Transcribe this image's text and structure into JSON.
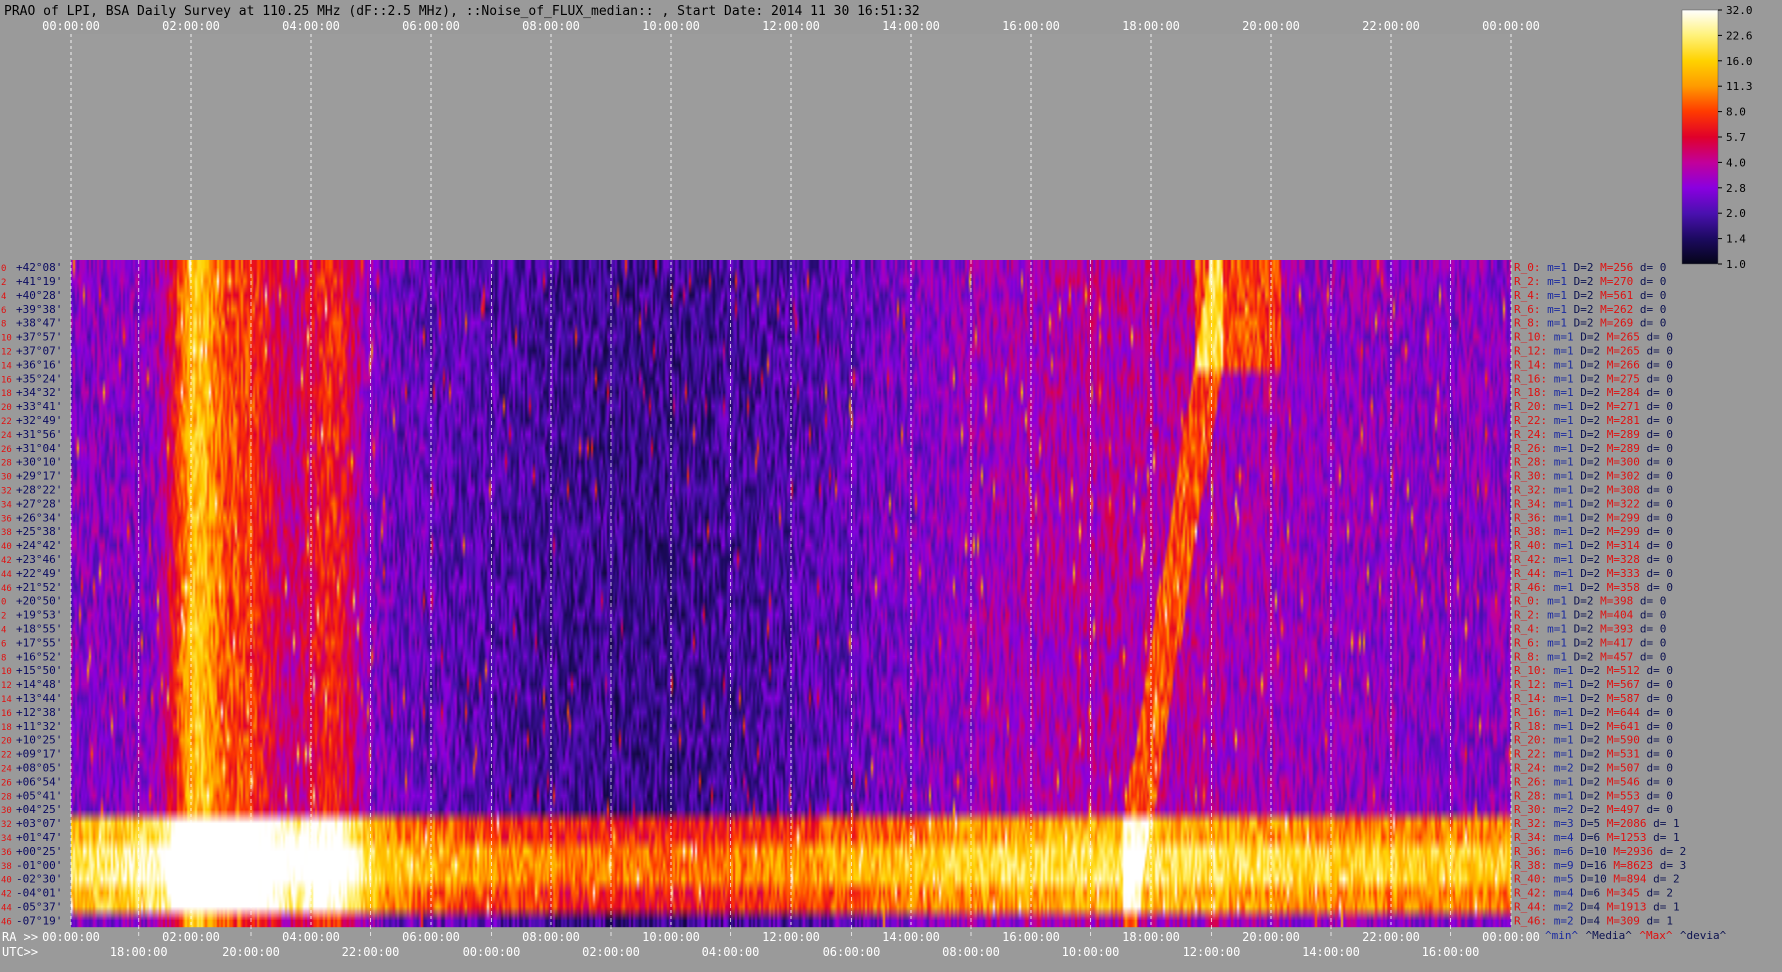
{
  "header": {
    "title": "PRAO of LPI, BSA Daily Survey at 110.25 MHz (dF::2.5 MHz), ::Noise_of_FLUX_median:: , Start Date: 2014 11 30 16:51:32"
  },
  "colorbar": {
    "ticks": [
      "32.0",
      "22.6",
      "16.0",
      "11.3",
      "8.0",
      "5.7",
      "4.0",
      "2.8",
      "2.0",
      "1.4",
      "1.0"
    ],
    "colors": [
      "#ffffff",
      "#fff27a",
      "#ffd200",
      "#ff9a00",
      "#ff3a00",
      "#e0002a",
      "#c2009a",
      "#8a00e0",
      "#4a10b0",
      "#1c0a60",
      "#050518"
    ]
  },
  "footer": {
    "ra_label": "RA >>",
    "utc_label": "UTC>>",
    "legend": [
      {
        "text": "^min^",
        "color": "#1a2aa0"
      },
      {
        "text": "^Media^",
        "color": "#0c1250"
      },
      {
        "text": "^Max^",
        "color": "#e01010"
      },
      {
        "text": "^devia^",
        "color": "#0c1250"
      }
    ]
  },
  "chart_data": {
    "type": "heatmap",
    "title": "PRAO of LPI, BSA Daily Survey at 110.25 MHz (dF::2.5 MHz), ::Noise_of_FLUX_median:: , Start Date: 2014 11 30 16:51:32",
    "top_ticks": [
      "00:00:00",
      "02:00:00",
      "04:00:00",
      "06:00:00",
      "08:00:00",
      "10:00:00",
      "12:00:00",
      "14:00:00",
      "16:00:00",
      "18:00:00",
      "20:00:00",
      "22:00:00",
      "00:00:00"
    ],
    "ra_ticks": [
      "00:00:00",
      "02:00:00",
      "04:00:00",
      "06:00:00",
      "08:00:00",
      "10:00:00",
      "12:00:00",
      "14:00:00",
      "16:00:00",
      "18:00:00",
      "20:00:00",
      "22:00:00",
      "00:00:00"
    ],
    "utc_ticks": [
      "18:00:00",
      "20:00:00",
      "22:00:00",
      "00:00:00",
      "02:00:00",
      "04:00:00",
      "06:00:00",
      "08:00:00",
      "10:00:00",
      "12:00:00",
      "14:00:00",
      "16:00:00"
    ],
    "dec_labels": [
      "+42°08'",
      "+41°19'",
      "+40°28'",
      "+39°38'",
      "+38°47'",
      "+37°57'",
      "+37°07'",
      "+36°16'",
      "+35°24'",
      "+34°32'",
      "+33°41'",
      "+32°49'",
      "+31°56'",
      "+31°04'",
      "+30°10'",
      "+29°17'",
      "+28°22'",
      "+27°28'",
      "+26°34'",
      "+25°38'",
      "+24°42'",
      "+23°46'",
      "+22°49'",
      "+21°52'",
      "+20°50'",
      "+19°53'",
      "+18°55'",
      "+17°55'",
      "+16°52'",
      "+15°50'",
      "+14°48'",
      "+13°44'",
      "+12°38'",
      "+11°32'",
      "+10°25'",
      "+09°17'",
      "+08°05'",
      "+06°54'",
      "+05°41'",
      "+04°25'",
      "+03°07'",
      "+01°47'",
      "+00°25'",
      "-01°00'",
      "-02°30'",
      "-04°01'",
      "-05°37'",
      "-07°19'"
    ],
    "row_indices": [
      "0",
      "2",
      "4",
      "6",
      "8",
      "10",
      "12",
      "14",
      "16",
      "18",
      "20",
      "22",
      "24",
      "26",
      "28",
      "30",
      "32",
      "34",
      "36",
      "38",
      "40",
      "42",
      "44",
      "46",
      "0",
      "2",
      "4",
      "6",
      "8",
      "10",
      "12",
      "14",
      "16",
      "18",
      "20",
      "22",
      "24",
      "26",
      "28",
      "30",
      "32",
      "34",
      "36",
      "38",
      "40",
      "42",
      "44",
      "46"
    ],
    "row_stats": [
      {
        "r": "R_0:",
        "m": "m=1",
        "D": "D=2",
        "M": "M=256",
        "d": "d= 0"
      },
      {
        "r": "R_2:",
        "m": "m=1",
        "D": "D=2",
        "M": "M=270",
        "d": "d= 0"
      },
      {
        "r": "R_4:",
        "m": "m=1",
        "D": "D=2",
        "M": "M=561",
        "d": "d= 0"
      },
      {
        "r": "R_6:",
        "m": "m=1",
        "D": "D=2",
        "M": "M=262",
        "d": "d= 0"
      },
      {
        "r": "R_8:",
        "m": "m=1",
        "D": "D=2",
        "M": "M=269",
        "d": "d= 0"
      },
      {
        "r": "R_10:",
        "m": "m=1",
        "D": "D=2",
        "M": "M=265",
        "d": "d= 0"
      },
      {
        "r": "R_12:",
        "m": "m=1",
        "D": "D=2",
        "M": "M=265",
        "d": "d= 0"
      },
      {
        "r": "R_14:",
        "m": "m=1",
        "D": "D=2",
        "M": "M=266",
        "d": "d= 0"
      },
      {
        "r": "R_16:",
        "m": "m=1",
        "D": "D=2",
        "M": "M=275",
        "d": "d= 0"
      },
      {
        "r": "R_18:",
        "m": "m=1",
        "D": "D=2",
        "M": "M=284",
        "d": "d= 0"
      },
      {
        "r": "R_20:",
        "m": "m=1",
        "D": "D=2",
        "M": "M=271",
        "d": "d= 0"
      },
      {
        "r": "R_22:",
        "m": "m=1",
        "D": "D=2",
        "M": "M=281",
        "d": "d= 0"
      },
      {
        "r": "R_24:",
        "m": "m=1",
        "D": "D=2",
        "M": "M=289",
        "d": "d= 0"
      },
      {
        "r": "R_26:",
        "m": "m=1",
        "D": "D=2",
        "M": "M=289",
        "d": "d= 0"
      },
      {
        "r": "R_28:",
        "m": "m=1",
        "D": "D=2",
        "M": "M=300",
        "d": "d= 0"
      },
      {
        "r": "R_30:",
        "m": "m=1",
        "D": "D=2",
        "M": "M=302",
        "d": "d= 0"
      },
      {
        "r": "R_32:",
        "m": "m=1",
        "D": "D=2",
        "M": "M=308",
        "d": "d= 0"
      },
      {
        "r": "R_34:",
        "m": "m=1",
        "D": "D=2",
        "M": "M=322",
        "d": "d= 0"
      },
      {
        "r": "R_36:",
        "m": "m=1",
        "D": "D=2",
        "M": "M=299",
        "d": "d= 0"
      },
      {
        "r": "R_38:",
        "m": "m=1",
        "D": "D=2",
        "M": "M=299",
        "d": "d= 0"
      },
      {
        "r": "R_40:",
        "m": "m=1",
        "D": "D=2",
        "M": "M=314",
        "d": "d= 0"
      },
      {
        "r": "R_42:",
        "m": "m=1",
        "D": "D=2",
        "M": "M=328",
        "d": "d= 0"
      },
      {
        "r": "R_44:",
        "m": "m=1",
        "D": "D=2",
        "M": "M=333",
        "d": "d= 0"
      },
      {
        "r": "R_46:",
        "m": "m=1",
        "D": "D=2",
        "M": "M=358",
        "d": "d= 0"
      },
      {
        "r": "R_0:",
        "m": "m=1",
        "D": "D=2",
        "M": "M=398",
        "d": "d= 0"
      },
      {
        "r": "R_2:",
        "m": "m=1",
        "D": "D=2",
        "M": "M=404",
        "d": "d= 0"
      },
      {
        "r": "R_4:",
        "m": "m=1",
        "D": "D=2",
        "M": "M=393",
        "d": "d= 0"
      },
      {
        "r": "R_6:",
        "m": "m=1",
        "D": "D=2",
        "M": "M=417",
        "d": "d= 0"
      },
      {
        "r": "R_8:",
        "m": "m=1",
        "D": "D=2",
        "M": "M=457",
        "d": "d= 0"
      },
      {
        "r": "R_10:",
        "m": "m=1",
        "D": "D=2",
        "M": "M=512",
        "d": "d= 0"
      },
      {
        "r": "R_12:",
        "m": "m=1",
        "D": "D=2",
        "M": "M=567",
        "d": "d= 0"
      },
      {
        "r": "R_14:",
        "m": "m=1",
        "D": "D=2",
        "M": "M=587",
        "d": "d= 0"
      },
      {
        "r": "R_16:",
        "m": "m=1",
        "D": "D=2",
        "M": "M=644",
        "d": "d= 0"
      },
      {
        "r": "R_18:",
        "m": "m=1",
        "D": "D=2",
        "M": "M=641",
        "d": "d= 0"
      },
      {
        "r": "R_20:",
        "m": "m=1",
        "D": "D=2",
        "M": "M=590",
        "d": "d= 0"
      },
      {
        "r": "R_22:",
        "m": "m=1",
        "D": "D=2",
        "M": "M=531",
        "d": "d= 0"
      },
      {
        "r": "R_24:",
        "m": "m=2",
        "D": "D=2",
        "M": "M=507",
        "d": "d= 0"
      },
      {
        "r": "R_26:",
        "m": "m=1",
        "D": "D=2",
        "M": "M=546",
        "d": "d= 0"
      },
      {
        "r": "R_28:",
        "m": "m=1",
        "D": "D=2",
        "M": "M=553",
        "d": "d= 0"
      },
      {
        "r": "R_30:",
        "m": "m=2",
        "D": "D=2",
        "M": "M=497",
        "d": "d= 0"
      },
      {
        "r": "R_32:",
        "m": "m=3",
        "D": "D=5",
        "M": "M=2086",
        "d": "d= 1"
      },
      {
        "r": "R_34:",
        "m": "m=4",
        "D": "D=6",
        "M": "M=1253",
        "d": "d= 1"
      },
      {
        "r": "R_36:",
        "m": "m=6",
        "D": "D=10",
        "M": "M=2936",
        "d": "d= 2"
      },
      {
        "r": "R_38:",
        "m": "m=9",
        "D": "D=16",
        "M": "M=8623",
        "d": "d= 3"
      },
      {
        "r": "R_40:",
        "m": "m=5",
        "D": "D=10",
        "M": "M=894",
        "d": "d= 2"
      },
      {
        "r": "R_42:",
        "m": "m=4",
        "D": "D=6",
        "M": "M=345",
        "d": "d= 2"
      },
      {
        "r": "R_44:",
        "m": "m=2",
        "D": "D=4",
        "M": "M=1913",
        "d": "d= 1"
      },
      {
        "r": "R_46:",
        "m": "m=2",
        "D": "D=4",
        "M": "M=309",
        "d": "d= 1"
      }
    ],
    "colorbar_range": [
      1.0,
      32.0
    ],
    "colorbar_scale": "log2"
  }
}
